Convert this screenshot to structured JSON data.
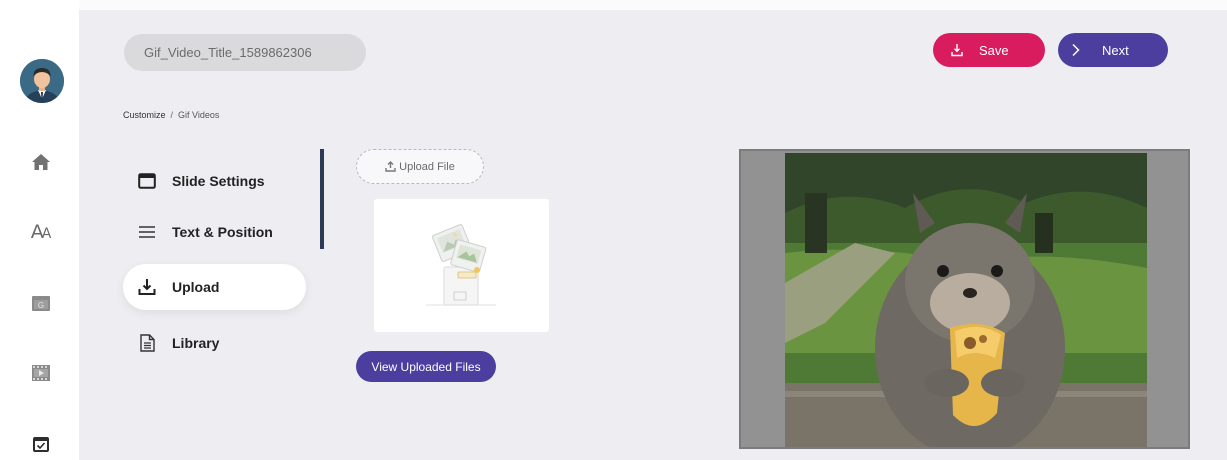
{
  "project": {
    "title": "Gif_Video_Title_1589862306"
  },
  "actions": {
    "save_label": "Save",
    "next_label": "Next"
  },
  "breadcrumb": {
    "parent": "Customize",
    "separator": "/",
    "current": "Gif Videos"
  },
  "menu": {
    "items": [
      {
        "label": "Slide Settings",
        "icon": "window-icon",
        "active": false
      },
      {
        "label": "Text & Position",
        "icon": "lines-icon",
        "active": false
      },
      {
        "label": "Upload",
        "icon": "download-icon",
        "active": true
      },
      {
        "label": "Library",
        "icon": "document-icon",
        "active": false
      }
    ]
  },
  "upload": {
    "button_label": "Upload File",
    "view_files_label": "View Uploaded Files"
  },
  "sidebar": {
    "icons": [
      "avatar",
      "home-icon",
      "font-icon",
      "gif-icon",
      "video-icon",
      "calendar-check-icon"
    ]
  },
  "colors": {
    "save": "#d81c5e",
    "primary": "#4c3e9f",
    "background": "#eeeef2",
    "scroll_indicator": "#2b3a55"
  }
}
